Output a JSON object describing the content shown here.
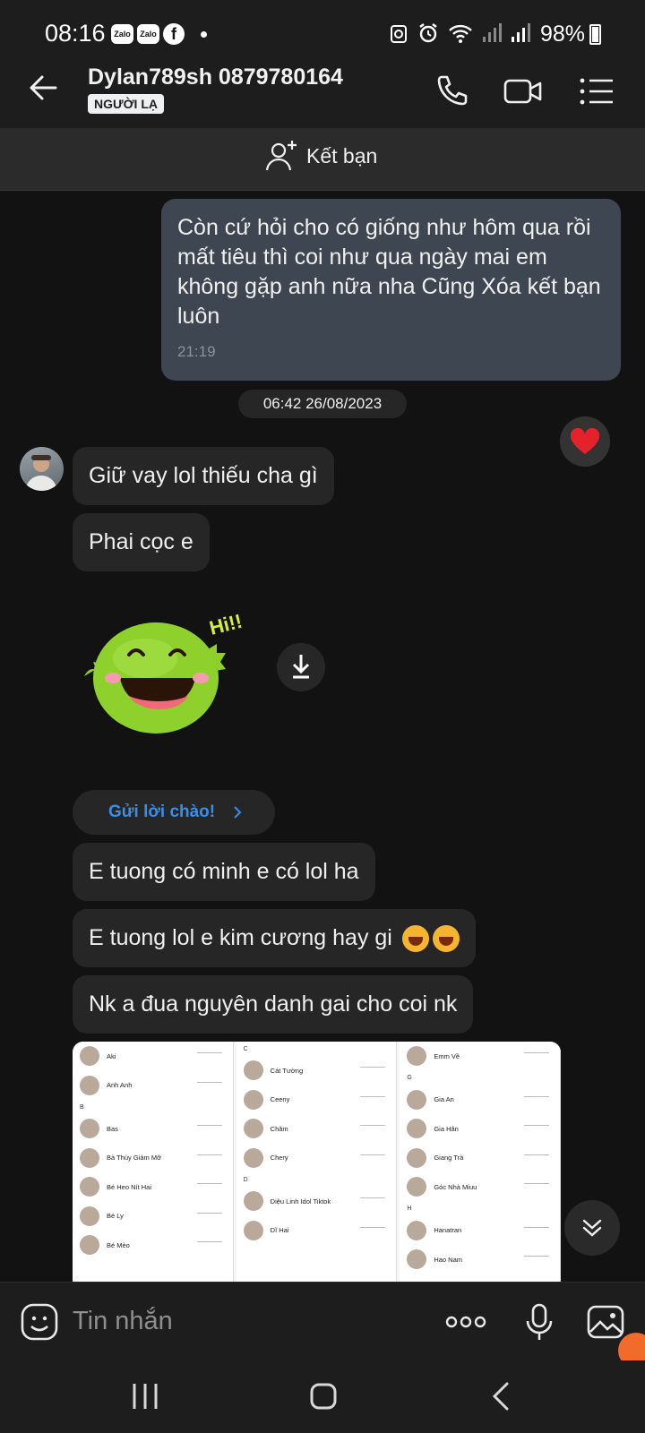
{
  "status": {
    "time": "08:16",
    "app_icons": [
      "zalo-icon",
      "zalo-icon",
      "facebook-icon"
    ],
    "zalo_label": "Zalo",
    "fb_label": "f",
    "battery": "98%"
  },
  "header": {
    "name": "Dylan789sh 0879780164",
    "badge": "NGƯỜI LẠ"
  },
  "add_friend": {
    "label": "Kết bạn"
  },
  "messages": {
    "sent_text": "Còn cứ hỏi cho có giống như hôm qua rồi mất tiêu thì coi như qua ngày mai em không gặp anh nữa nha Cũng Xóa kết bạn luôn",
    "sent_time": "21:19",
    "date_separator": "06:42 26/08/2023",
    "m1": "Giữ vay lol thiếu cha gì",
    "m2": "Phai cọc e",
    "sticker_text": "Hi!!",
    "greet_label": "Gửi lời chào!",
    "m3": "E tuong có minh e có lol ha",
    "m4": "E tuong lol e kim cương hay gi",
    "m5": "Nk a đua nguyên danh gai cho coi nk"
  },
  "contact_screenshot": {
    "col1": [
      {
        "name": "Aki"
      },
      {
        "name": "Anh Anh"
      },
      {
        "letter": "B"
      },
      {
        "name": "Bas"
      },
      {
        "name": "Bà Thủy Giám Mỡ"
      },
      {
        "name": "Bé Heo Nít Hai"
      },
      {
        "name": "Bé Ly"
      },
      {
        "name": "Bé Mèo"
      }
    ],
    "col2": [
      {
        "letter": "C"
      },
      {
        "name": "Cát Tường"
      },
      {
        "name": "Ceeny"
      },
      {
        "name": "Chăm"
      },
      {
        "name": "Chery"
      },
      {
        "letter": "D"
      },
      {
        "name": "Diệu Linh Idol Tiktok"
      },
      {
        "name": "Dĩ Hai"
      }
    ],
    "col3": [
      {
        "name": "Emm Về"
      },
      {
        "letter": "G"
      },
      {
        "name": "Gia An"
      },
      {
        "name": "Gia Hân"
      },
      {
        "name": "Giang Trà"
      },
      {
        "name": "Góc Nhà Miuu"
      },
      {
        "letter": "H"
      },
      {
        "name": "Hanatran"
      },
      {
        "name": "Hao Nam"
      }
    ]
  },
  "input": {
    "placeholder": "Tin nhắn"
  }
}
